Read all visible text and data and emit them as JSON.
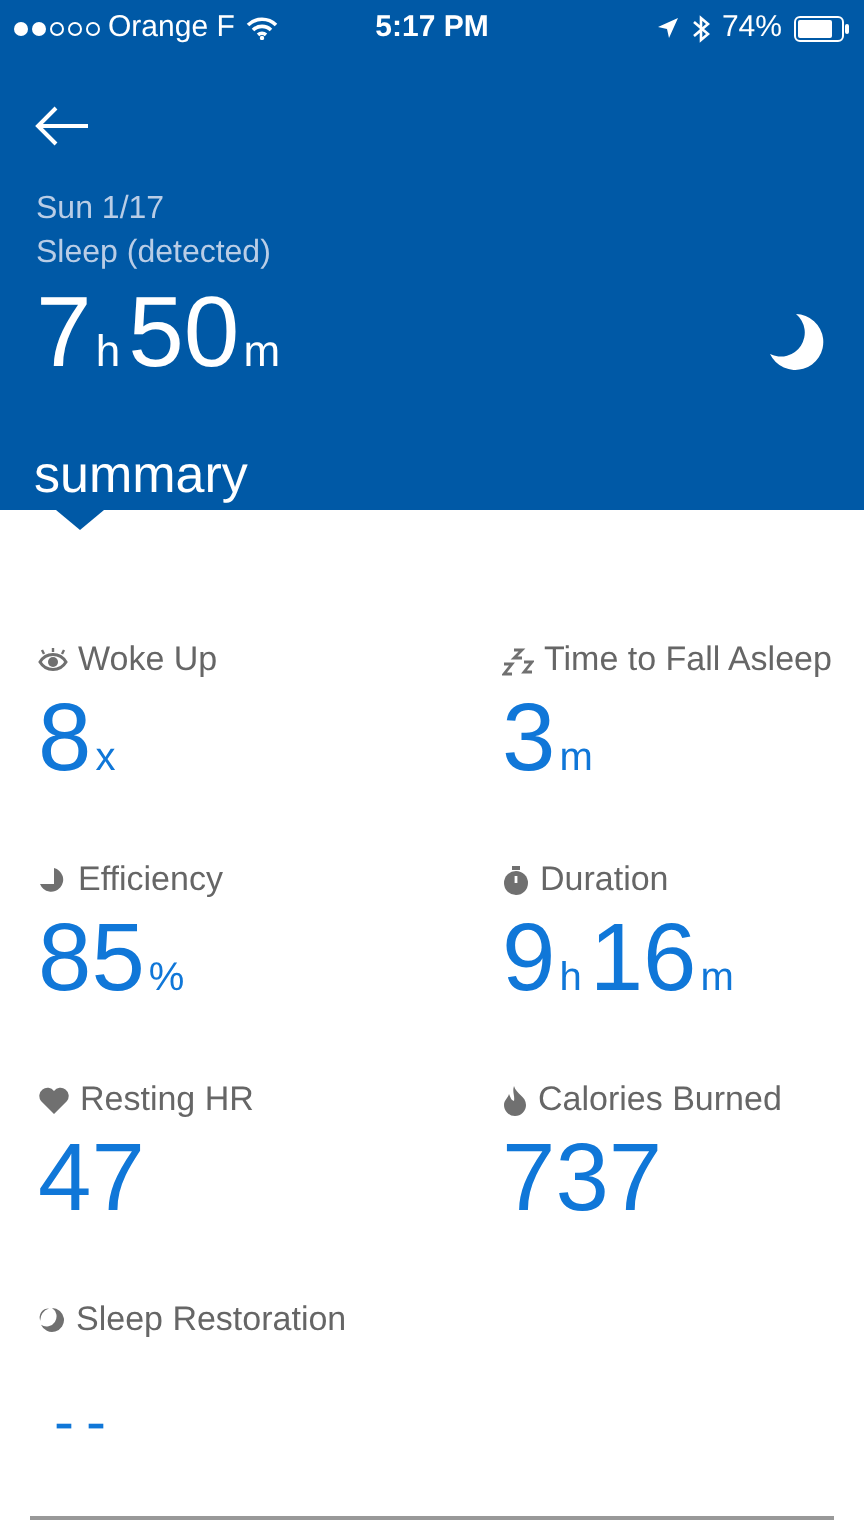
{
  "status_bar": {
    "carrier": "Orange F",
    "time": "5:17 PM",
    "battery": "74%"
  },
  "header": {
    "date": "Sun 1/17",
    "title": "Sleep (detected)",
    "total": [
      {
        "n": "7",
        "u": "h"
      },
      {
        "n": "50",
        "u": "m"
      }
    ],
    "section": "summary"
  },
  "metrics": [
    {
      "kind": "woke",
      "label": "Woke Up",
      "value": [
        {
          "n": "8",
          "u": "x"
        }
      ]
    },
    {
      "kind": "fall_asleep",
      "label": "Time to Fall Asleep",
      "value": [
        {
          "n": "3",
          "u": "m"
        }
      ]
    },
    {
      "kind": "efficiency",
      "label": "Efficiency",
      "value": [
        {
          "n": "85",
          "u": "%"
        }
      ]
    },
    {
      "kind": "duration",
      "label": "Duration",
      "value": [
        {
          "n": "9",
          "u": "h"
        },
        {
          "n": "16",
          "u": "m"
        }
      ]
    },
    {
      "kind": "heart",
      "label": "Resting HR",
      "value": [
        {
          "n": "47"
        }
      ]
    },
    {
      "kind": "calories",
      "label": "Calories Burned",
      "value": [
        {
          "n": "737"
        }
      ]
    },
    {
      "kind": "restoration",
      "label": "Sleep Restoration",
      "value": [
        {
          "n": "--"
        }
      ]
    }
  ]
}
